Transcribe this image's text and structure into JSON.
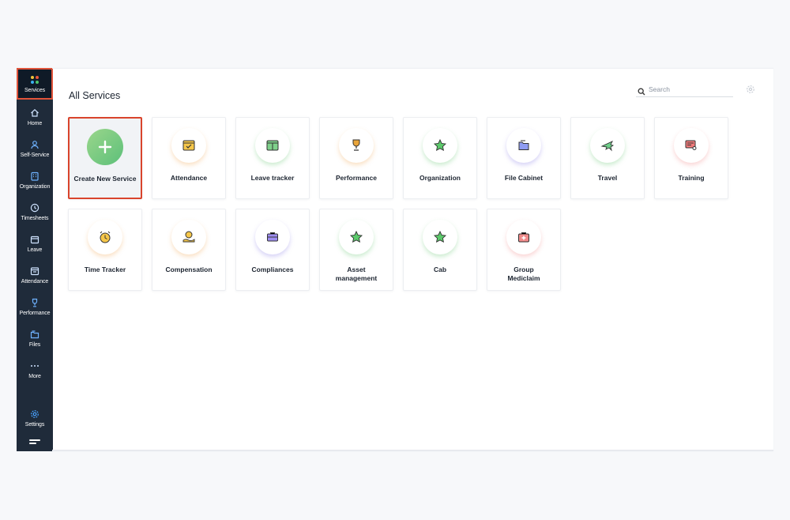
{
  "sidebar": {
    "items": [
      {
        "label": "Services"
      },
      {
        "label": "Home"
      },
      {
        "label": "Self-Service"
      },
      {
        "label": "Organization"
      },
      {
        "label": "Timesheets"
      },
      {
        "label": "Leave"
      },
      {
        "label": "Attendance"
      },
      {
        "label": "Performance"
      },
      {
        "label": "Files"
      },
      {
        "label": "More"
      },
      {
        "label": "Settings"
      }
    ]
  },
  "header": {
    "title": "All Services",
    "search_placeholder": "Search"
  },
  "services": {
    "create": "Create New Service",
    "attendance": "Attendance",
    "leave_tracker": "Leave tracker",
    "performance": "Performance",
    "organization": "Organization",
    "file_cabinet": "File Cabinet",
    "travel": "Travel",
    "training": "Training",
    "time_tracker": "Time Tracker",
    "compensation": "Compensation",
    "compliances": "Compliances",
    "asset_management": "Asset management",
    "cab": "Cab",
    "group_mediclaim": "Group Mediclaim"
  },
  "colors": {
    "sidebar_bg": "#1f2b3a",
    "highlight": "#d9442c",
    "plus_green": "#5dc07a"
  }
}
